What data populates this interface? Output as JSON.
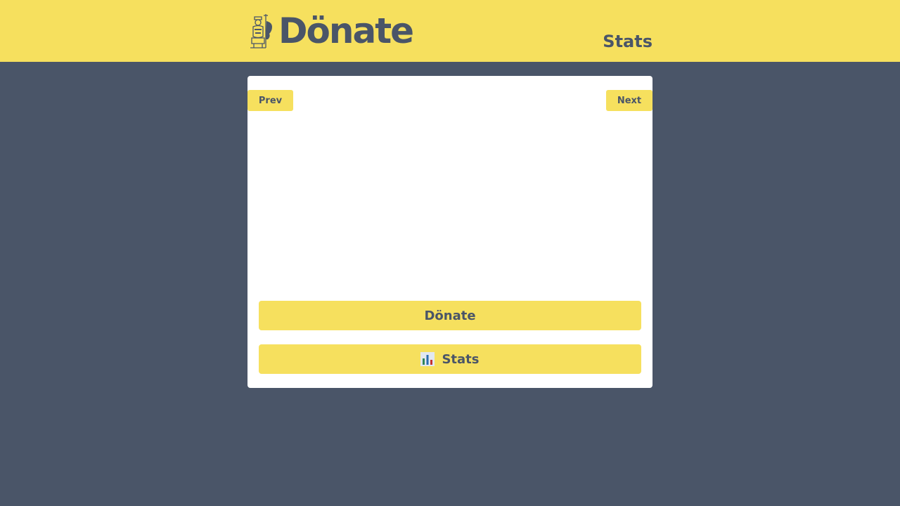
{
  "header": {
    "brand_title": "Dönate",
    "logo_icon": "doner-chef-icon",
    "nav_stats_label": "Stats"
  },
  "card": {
    "prev_label": "Prev",
    "next_label": "Next",
    "donate_label": "Dönate",
    "stats_label": "Stats",
    "stats_icon": "bar-chart-icon"
  },
  "colors": {
    "accent": "#f6e05e",
    "background": "#4a5568",
    "card": "#ffffff",
    "text": "#4a5568"
  }
}
